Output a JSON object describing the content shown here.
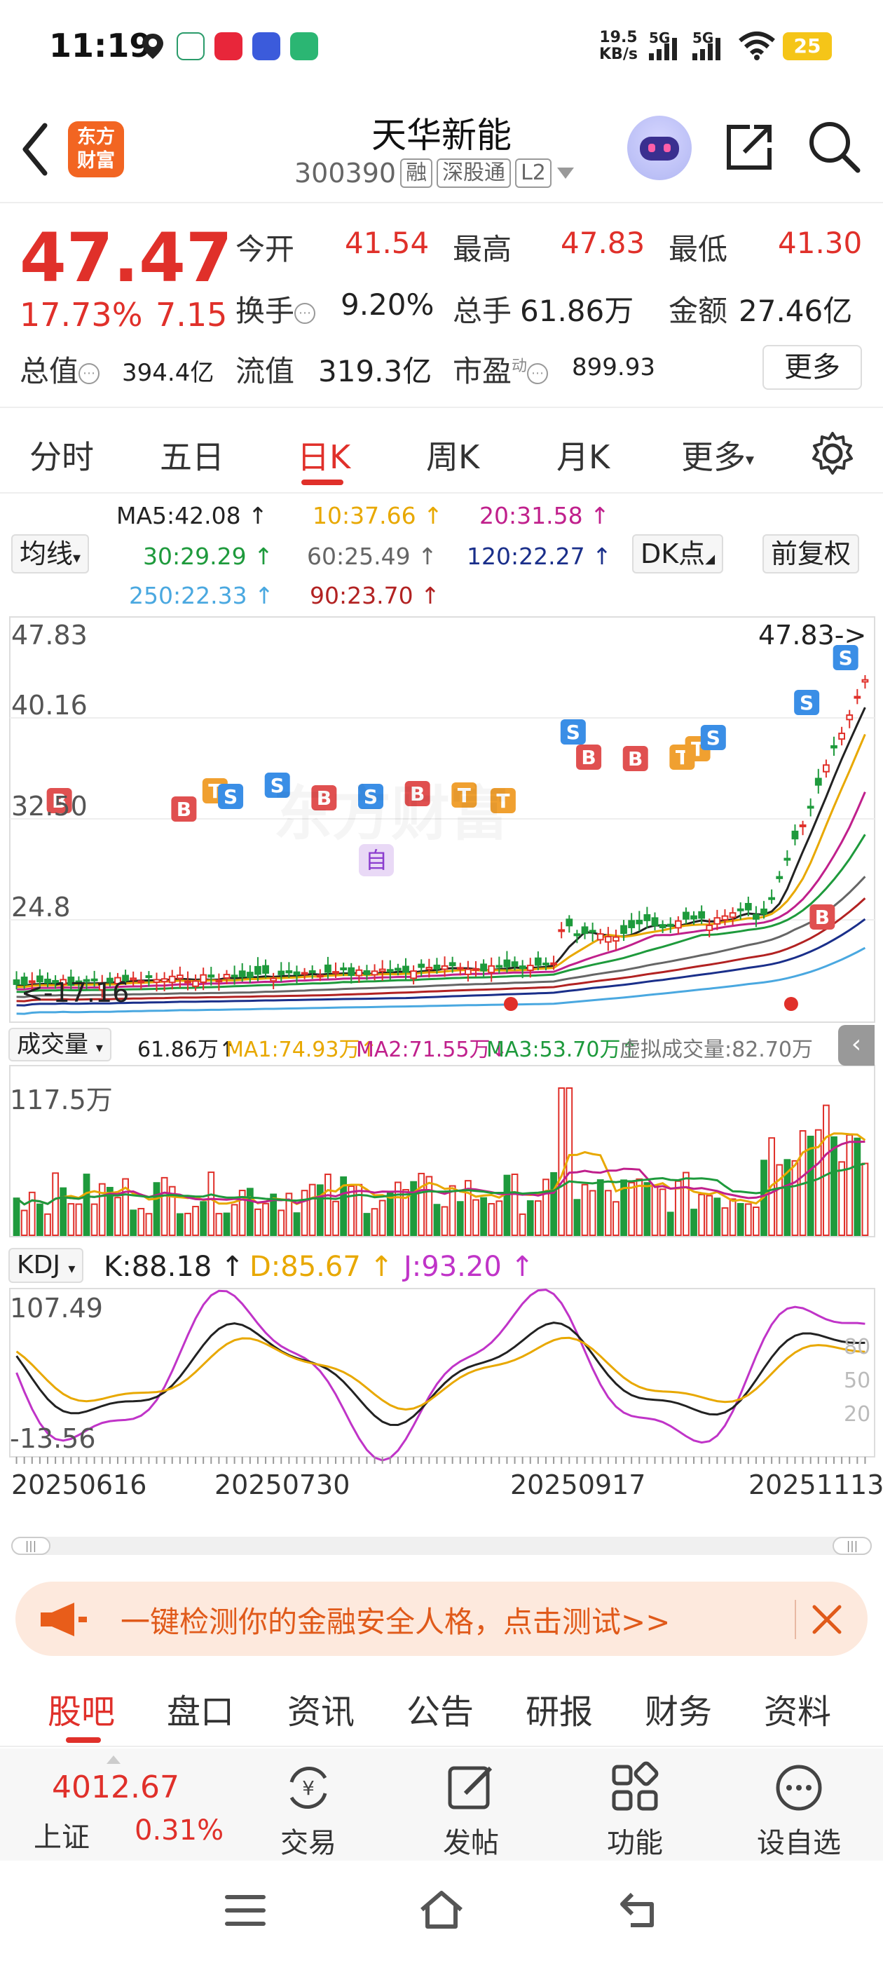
{
  "status_bar": {
    "time": "11:19",
    "net_speed_value": "19.5",
    "net_speed_unit": "KB/s",
    "sim1": "5G",
    "sim2": "5G",
    "battery": "25"
  },
  "header": {
    "logo_text_line1": "东方",
    "logo_text_line2": "财富",
    "stock_name": "天华新能",
    "stock_code": "300390",
    "tags": [
      "融",
      "深股通",
      "L2"
    ]
  },
  "quote": {
    "price": "47.47",
    "change_pct": "17.73%",
    "change_amt": "7.15",
    "open_label": "今开",
    "open": "41.54",
    "high_label": "最高",
    "high": "47.83",
    "low_label": "最低",
    "low": "41.30",
    "turnover_label": "换手",
    "turnover": "9.20%",
    "volume_label": "总手",
    "volume": "61.86万",
    "amount_label": "金额",
    "amount": "27.46亿",
    "mktcap_label": "总值",
    "mktcap": "394.4亿",
    "float_label": "流值",
    "float_cap": "319.3亿",
    "pe_label": "市盈",
    "pe_sup": "动",
    "pe": "899.93",
    "more_button": "更多"
  },
  "tabs": {
    "items": [
      "分时",
      "五日",
      "日K",
      "周K",
      "月K",
      "更多"
    ],
    "active": "日K"
  },
  "ma_legend": {
    "ma_button": "均线",
    "ma5": "MA5:42.08 ↑",
    "ma10": "10:37.66 ↑",
    "ma20": "20:31.58 ↑",
    "ma30": "30:29.29 ↑",
    "ma60": "60:25.49 ↑",
    "ma120": "120:22.27 ↑",
    "ma250": "250:22.33 ↑",
    "ma90": "90:23.70 ↑",
    "dk_button": "DK点",
    "adjust_button": "前复权",
    "colors": {
      "ma5": "#222222",
      "ma10": "#e8a800",
      "ma20": "#c0208c",
      "ma30": "#1e9a3c",
      "ma60": "#666666",
      "ma120": "#1a2f8a",
      "ma250": "#4aa8e0",
      "ma90": "#b22222"
    }
  },
  "price_chart": {
    "y_labels": [
      "47.83",
      "40.16",
      "32.50",
      "24.8"
    ],
    "low_label": "17.16",
    "high_annotation": "47.83->",
    "watermark": "东方财富",
    "marker_self": "自",
    "colors": {
      "up": "#e0302a",
      "down": "#1e9a3c"
    }
  },
  "volume_chart": {
    "button": "成交量",
    "value": "61.86万↑",
    "ma1": "MA1:74.93万↑",
    "ma2": "MA2:71.55万↓",
    "ma3": "MA3:53.70万↑",
    "virtual": "虚拟成交量:82.70万",
    "y_label": "117.5万"
  },
  "kdj_chart": {
    "button": "KDJ",
    "k": "K:88.18 ↑",
    "d": "D:85.67 ↑",
    "j": "J:93.20 ↑",
    "y_top": "107.49",
    "y_bottom": "-13.56",
    "right_80": "80",
    "right_50": "50",
    "right_20": "20"
  },
  "x_axis": {
    "dates": [
      "20250616",
      "20250730",
      "20250917",
      "20251113"
    ]
  },
  "promo": {
    "text": "一键检测你的金融安全人格，点击测试>>"
  },
  "section_tabs": {
    "items": [
      "股吧",
      "盘口",
      "资讯",
      "公告",
      "研报",
      "财务",
      "资料"
    ],
    "active": "股吧"
  },
  "toolbar": {
    "index_value": "4012.67",
    "index_name": "上证",
    "index_pct": "0.31%",
    "items": [
      "交易",
      "发帖",
      "功能",
      "设自选"
    ]
  }
}
